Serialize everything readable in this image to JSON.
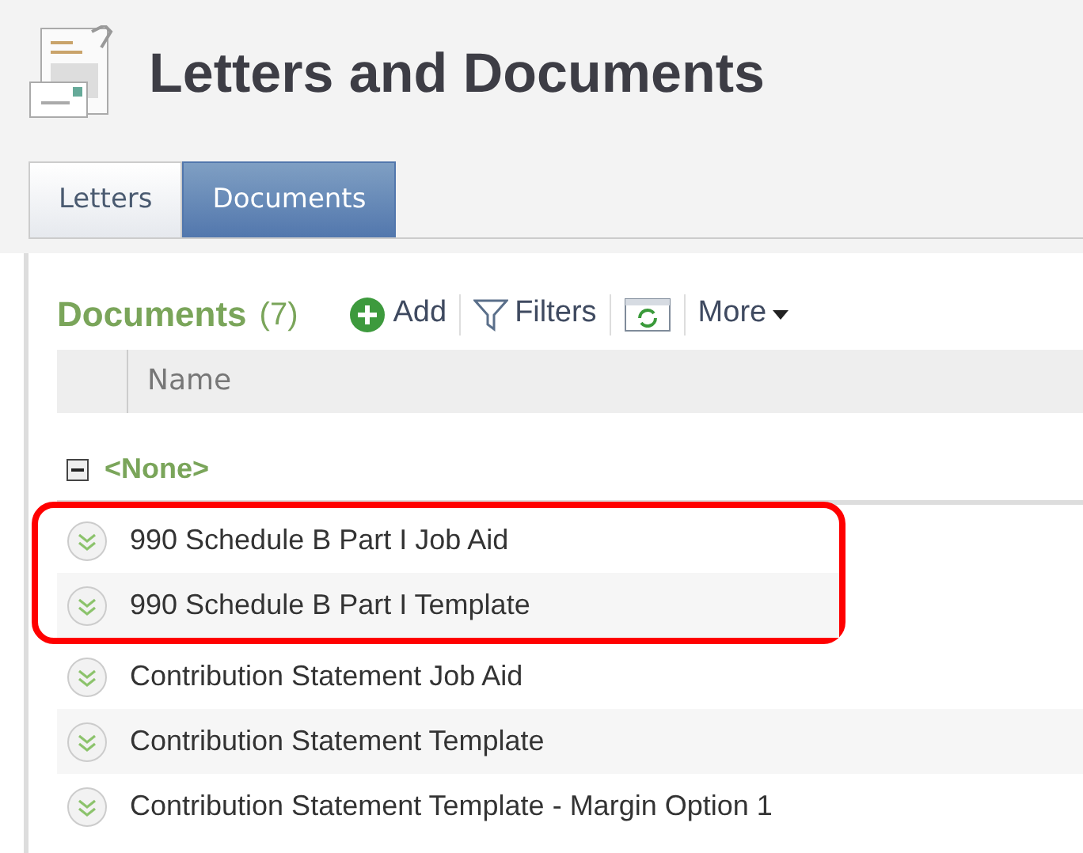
{
  "page": {
    "title": "Letters and Documents"
  },
  "tabs": [
    {
      "label": "Letters",
      "selected": false
    },
    {
      "label": "Documents",
      "selected": true
    }
  ],
  "section": {
    "title": "Documents",
    "count": "(7)"
  },
  "toolbar": [
    {
      "kind": "add",
      "label": "Add"
    },
    {
      "kind": "filter",
      "label": "Filters"
    },
    {
      "kind": "refresh"
    },
    {
      "kind": "more",
      "label": "More"
    }
  ],
  "table": {
    "columns": [
      "Name"
    ]
  },
  "group": {
    "label": "<None>",
    "expanded": true
  },
  "rows": [
    {
      "name": "990 Schedule B Part I Job Aid",
      "highlighted": true
    },
    {
      "name": "990 Schedule B Part I Template",
      "highlighted": true
    },
    {
      "name": "Contribution Statement Job Aid",
      "highlighted": false
    },
    {
      "name": "Contribution Statement Template",
      "highlighted": false
    },
    {
      "name": "Contribution Statement Template - Margin Option 1",
      "highlighted": false
    }
  ]
}
